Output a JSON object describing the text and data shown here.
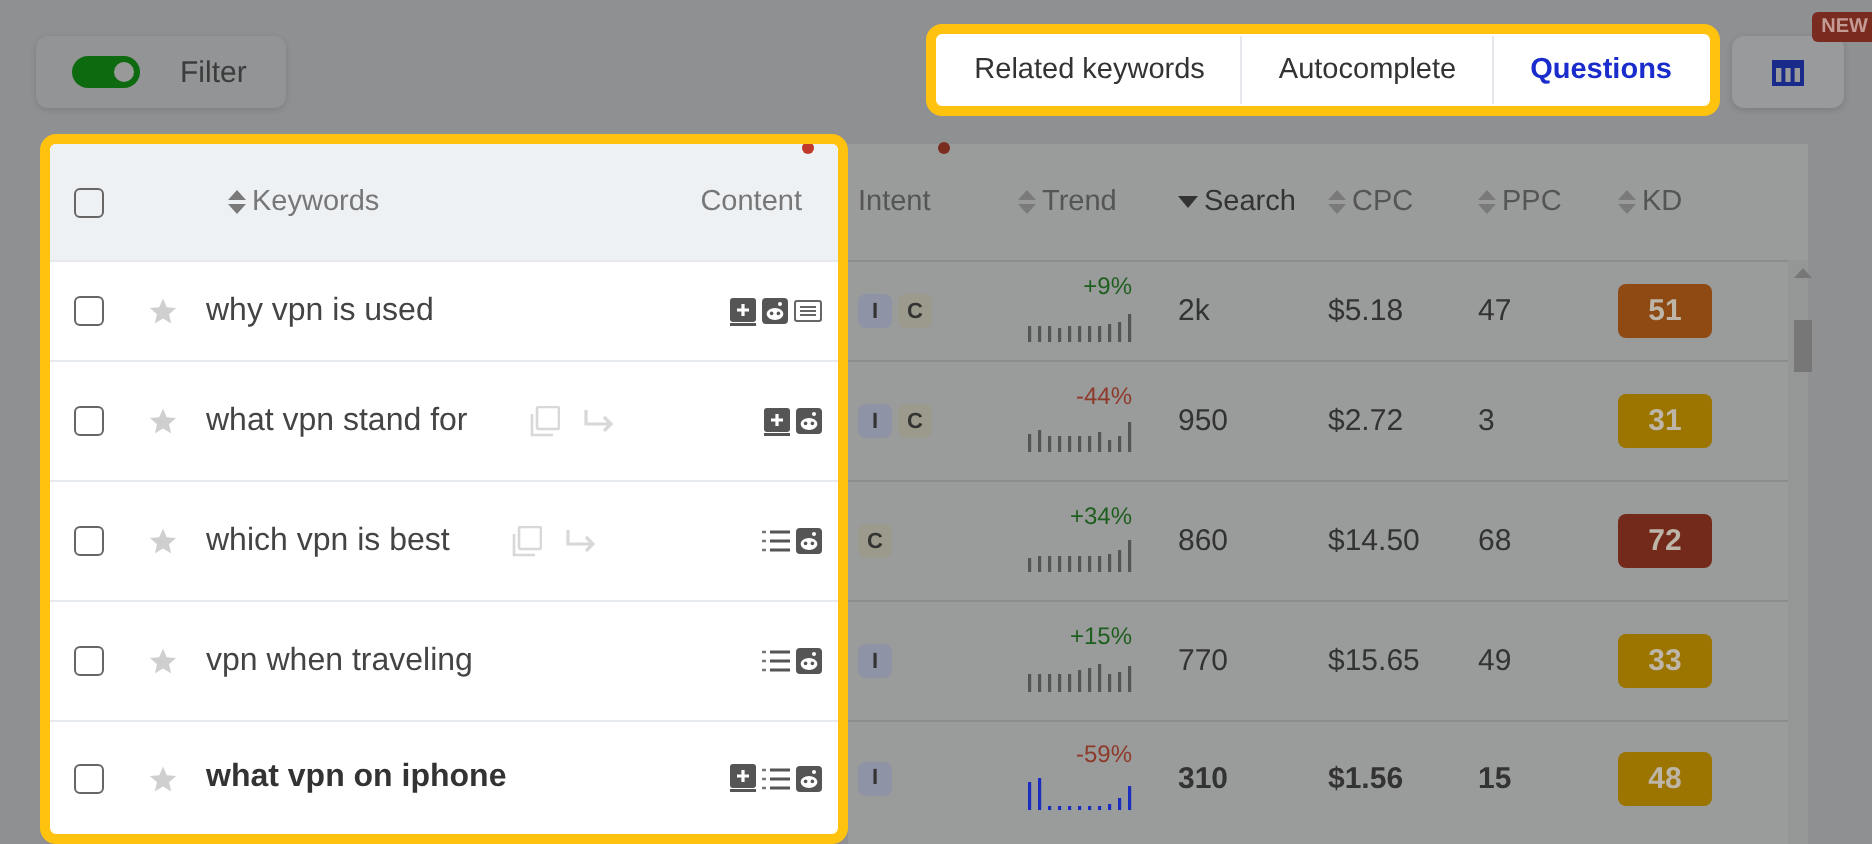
{
  "filter": {
    "label": "Filter",
    "on": true
  },
  "tabs": [
    {
      "label": "Related keywords",
      "selected": false
    },
    {
      "label": "Autocomplete",
      "selected": false
    },
    {
      "label": "Questions",
      "selected": true
    }
  ],
  "new_badge": "NEW",
  "select_all_checked": false,
  "columns": [
    {
      "label": "Keywords",
      "kind": "sortable",
      "dot": false
    },
    {
      "label": "Content",
      "kind": "plain",
      "dot": true
    },
    {
      "label": "Intent",
      "kind": "plain",
      "dot": true
    },
    {
      "label": "Trend",
      "kind": "sortable",
      "dot": false
    },
    {
      "label": "Search",
      "kind": "sorted",
      "dot": false
    },
    {
      "label": "CPC",
      "kind": "sortable",
      "dot": false
    },
    {
      "label": "PPC",
      "kind": "sortable",
      "dot": false
    },
    {
      "label": "KD",
      "kind": "sortable",
      "dot": false
    }
  ],
  "rows": [
    {
      "keyword": "why vpn is used",
      "checked": false,
      "starred": false,
      "bold": false,
      "actions": false,
      "content": [
        {
          "kind": "add"
        },
        {
          "kind": "reddit"
        },
        {
          "kind": "news"
        }
      ],
      "intent": [
        {
          "label": "I",
          "color": "#8e93a6"
        },
        {
          "label": "C",
          "color": "#9c9a8c"
        }
      ],
      "trend": {
        "change": "+9%",
        "kind": "up"
      },
      "search": "2k",
      "cpc": "$5.18",
      "ppc": "47",
      "kd": "51",
      "color": "#8f4a14"
    },
    {
      "keyword": "what vpn stand for",
      "checked": false,
      "starred": false,
      "bold": false,
      "actions": true,
      "content": [
        {
          "kind": "add"
        },
        {
          "kind": "reddit"
        }
      ],
      "intent": [
        {
          "label": "I",
          "color": "#8e93a6"
        },
        {
          "label": "C",
          "color": "#9c9a8c"
        }
      ],
      "trend": {
        "change": "-44%",
        "kind": "down"
      },
      "search": "950",
      "cpc": "$2.72",
      "ppc": "3",
      "kd": "31",
      "color": "#9c7400"
    },
    {
      "keyword": "which vpn is best",
      "checked": false,
      "starred": false,
      "bold": false,
      "actions": true,
      "content": [
        {
          "kind": "list"
        },
        {
          "kind": "reddit"
        }
      ],
      "intent": [
        {
          "label": "C",
          "color": "#9c9a8c"
        }
      ],
      "trend": {
        "change": "+34%",
        "kind": "up"
      },
      "search": "860",
      "cpc": "$14.50",
      "ppc": "68",
      "kd": "72",
      "color": "#732a1a"
    },
    {
      "keyword": "vpn when traveling",
      "checked": false,
      "starred": false,
      "bold": false,
      "actions": false,
      "content": [
        {
          "kind": "list"
        },
        {
          "kind": "reddit"
        }
      ],
      "intent": [
        {
          "label": "I",
          "color": "#8e93a6"
        }
      ],
      "trend": {
        "change": "+15%",
        "kind": "up"
      },
      "search": "770",
      "cpc": "$15.65",
      "ppc": "49",
      "kd": "33",
      "color": "#9c7400"
    },
    {
      "keyword": "what vpn on iphone",
      "checked": false,
      "starred": false,
      "bold": true,
      "actions": false,
      "content": [
        {
          "kind": "add"
        },
        {
          "kind": "list"
        },
        {
          "kind": "reddit"
        }
      ],
      "intent": [
        {
          "label": "I",
          "color": "#8e93a6"
        }
      ],
      "trend": {
        "change": "-59%",
        "kind": "down"
      },
      "search": "310",
      "cpc": "$1.56",
      "ppc": "15",
      "kd": "48",
      "color": "#9c7400"
    }
  ]
}
